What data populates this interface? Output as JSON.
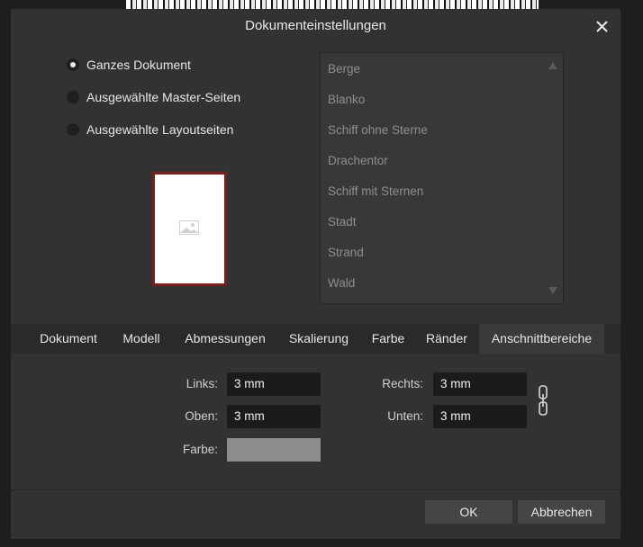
{
  "dialog": {
    "title": "Dokumenteinstellungen",
    "close_icon": "close-icon"
  },
  "scope": {
    "options": [
      {
        "label": "Ganzes Dokument",
        "checked": true
      },
      {
        "label": "Ausgewählte Master-Seiten",
        "checked": false
      },
      {
        "label": "Ausgewählte Layoutseiten",
        "checked": false
      }
    ]
  },
  "preview": {
    "icon": "image-placeholder-icon",
    "border_color": "#7a1e1e"
  },
  "master_list": {
    "items": [
      "Berge",
      "Blanko",
      "Schiff ohne Sterne",
      "Drachentor",
      "Schiff mit Sternen",
      "Stadt",
      "Strand",
      "Wald"
    ]
  },
  "tabs": {
    "items": [
      "Dokument",
      "Modell",
      "Abmessungen",
      "Skalierung",
      "Farbe",
      "Ränder",
      "Anschnittbereiche"
    ],
    "active": "Anschnittbereiche"
  },
  "bleed": {
    "left_label": "Links:",
    "left_value": "3 mm",
    "top_label": "Oben:",
    "top_value": "3 mm",
    "right_label": "Rechts:",
    "right_value": "3 mm",
    "bottom_label": "Unten:",
    "bottom_value": "3 mm",
    "color_label": "Farbe:",
    "color_value": "#8c8c8c",
    "link_icon": "chain-link-icon"
  },
  "buttons": {
    "ok": "OK",
    "cancel": "Abbrechen"
  }
}
